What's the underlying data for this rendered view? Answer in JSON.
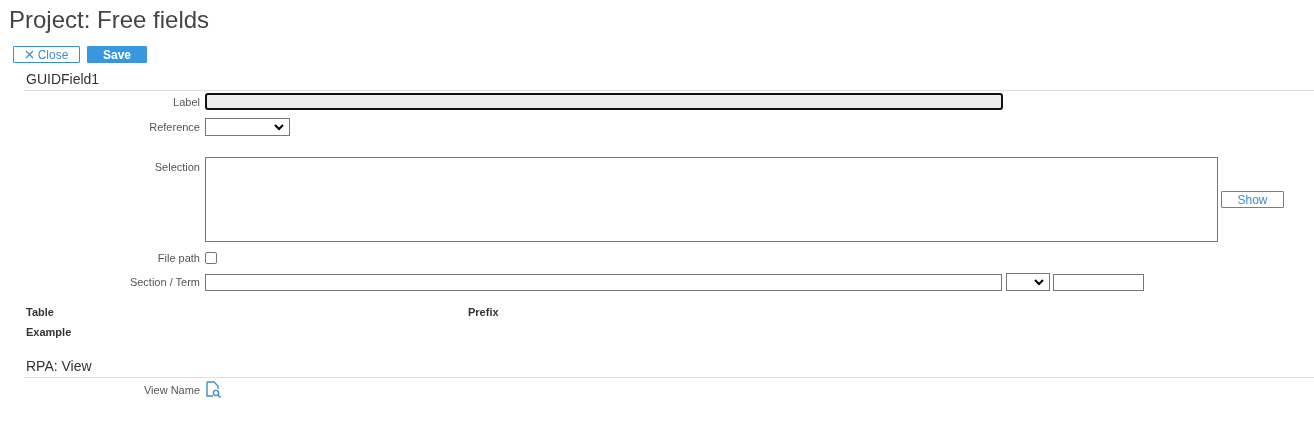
{
  "title": "Project: Free fields",
  "toolbar": {
    "close": "Close",
    "save": "Save"
  },
  "sections": [
    {
      "heading": "GUIDField1",
      "fields": [
        {
          "kind": "text",
          "label": "Label",
          "focused": true
        },
        {
          "kind": "select",
          "label": "Reference"
        },
        {
          "kind": "textarea",
          "label": "Selection",
          "button": "Show"
        },
        {
          "kind": "checkbox",
          "label": "File path",
          "checked": false
        },
        {
          "kind": "term",
          "label": "Section / Term"
        }
      ],
      "info": [
        {
          "label": "Table",
          "label_2": "Prefix"
        },
        {
          "label": "Example"
        }
      ]
    },
    {
      "heading": "RPA: View",
      "fields": [
        {
          "kind": "icon",
          "label": "View Name"
        }
      ]
    }
  ]
}
